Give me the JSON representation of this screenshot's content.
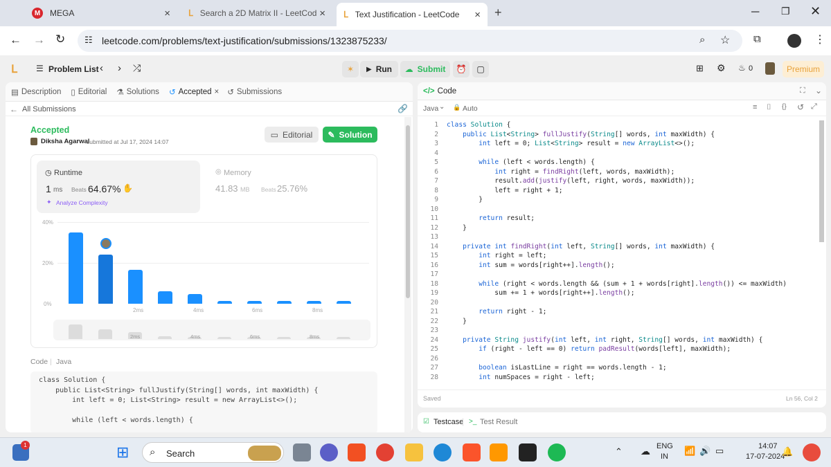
{
  "browser": {
    "tabs": [
      {
        "title": "MEGA",
        "icon": "mega-icon"
      },
      {
        "title": "Search a 2D Matrix II - LeetCod",
        "icon": "leetcode-icon"
      },
      {
        "title": "Text Justification - LeetCode",
        "icon": "leetcode-icon"
      }
    ],
    "new_tab": "+",
    "url": "leetcode.com/problems/text-justification/submissions/1323875233/"
  },
  "header": {
    "problem_list": "Problem List",
    "run": "Run",
    "submit": "Submit",
    "streak": "0",
    "premium": "Premium"
  },
  "left": {
    "tabs": [
      "Description",
      "Editorial",
      "Solutions",
      "Accepted",
      "Submissions"
    ],
    "back": "All Submissions",
    "status": "Accepted",
    "author": "Diksha Agarwal",
    "submitted": "submitted at Jul 17, 2024 14:07",
    "editorial_btn": "Editorial",
    "solution_btn": "Solution",
    "runtime_label": "Runtime",
    "runtime_value": "1",
    "runtime_unit": "ms",
    "beats_label": "Beats",
    "runtime_beats": "64.67%",
    "analyze": "Analyze Complexity",
    "memory_label": "Memory",
    "memory_value": "41.83",
    "memory_unit": "MB",
    "memory_beats": "25.76%",
    "code_label": "Code",
    "lang": "Java",
    "snippet": [
      "class Solution {",
      "    public List<String> fullJustify(String[] words, int maxWidth) {",
      "        int left = 0; List<String> result = new ArrayList<>();",
      "",
      "        while (left < words.length) {",
      "            int right = findRight(left, words, maxWidth);"
    ]
  },
  "chart_data": {
    "type": "bar",
    "yticks": [
      "40%",
      "20%",
      "0%"
    ],
    "xticks": [
      "2ms",
      "4ms",
      "6ms",
      "8ms"
    ],
    "values": [
      35,
      24,
      16.5,
      6,
      4.7,
      1.2,
      1.2,
      1.2,
      1.2,
      1.2
    ],
    "highlight_index": 1,
    "ylim": [
      0,
      40
    ],
    "mini_xticks": [
      "2ms",
      "4ms",
      "6ms",
      "8ms"
    ]
  },
  "right": {
    "title": "Code",
    "lang": "Java",
    "mode": "Auto",
    "saved": "Saved",
    "cursor": "Ln 56, Col 2",
    "testcase": "Testcase",
    "test_result": "Test Result",
    "lines": [
      "class Solution {",
      "    public List<String> fullJustify(String[] words, int maxWidth) {",
      "        int left = 0; List<String> result = new ArrayList<>();",
      "",
      "        while (left < words.length) {",
      "            int right = findRight(left, words, maxWidth);",
      "            result.add(justify(left, right, words, maxWidth));",
      "            left = right + 1;",
      "        }",
      "",
      "        return result;",
      "    }",
      "",
      "    private int findRight(int left, String[] words, int maxWidth) {",
      "        int right = left;",
      "        int sum = words[right++].length();",
      "",
      "        while (right < words.length && (sum + 1 + words[right].length()) <= maxWidth)",
      "            sum += 1 + words[right++].length();",
      "",
      "        return right - 1;",
      "    }",
      "",
      "    private String justify(int left, int right, String[] words, int maxWidth) {",
      "        if (right - left == 0) return padResult(words[left], maxWidth);",
      "",
      "        boolean isLastLine = right == words.length - 1;",
      "        int numSpaces = right - left;"
    ]
  },
  "taskbar": {
    "search": "Search",
    "lang1": "ENG",
    "lang2": "IN",
    "time": "14:07",
    "date": "17-07-2024",
    "badge": "1"
  }
}
